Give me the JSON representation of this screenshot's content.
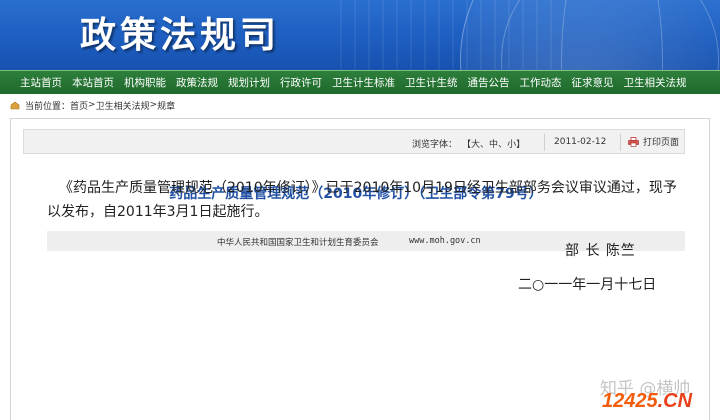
{
  "banner": {
    "title": "政策法规司"
  },
  "nav": {
    "items": [
      "主站首页",
      "本站首页",
      "机构职能",
      "政策法规",
      "规划计划",
      "行政许可",
      "卫生计生标准",
      "卫生计生统",
      "通告公告",
      "工作动态",
      "征求意见",
      "卫生相关法规"
    ]
  },
  "breadcrumb": {
    "label": "当前位置：",
    "home": "首页",
    "sep1": ">",
    "section": "卫生相关法规",
    "sep2": ">",
    "current": "规章"
  },
  "toolbar": {
    "font_label": "浏览字体：",
    "font_open": "【",
    "font_large": "大",
    "font_medium": "中",
    "font_small": "小",
    "font_close": "】",
    "font_sep1": "、",
    "font_sep2": "、",
    "date": "2011-02-12",
    "print": "打印页面"
  },
  "article": {
    "title": "药品生产质量管理规范（2010年修订）（卫生部令第79号）",
    "source_org": "中华人民共和国国家卫生和计划生育委员会",
    "source_site": "www.moh.gov.cn",
    "body": "《药品生产质量管理规范（2010年修订）》已于2010年10月19日经卫生部部务会议审议通过，现予以发布，自2011年3月1日起施行。",
    "sign": "部 长  陈竺",
    "sign_date": "二○一一年一月十七日"
  },
  "watermarks": {
    "zhihu": "知乎 @横帅",
    "site_num": "12425",
    "site_tld": ".CN"
  },
  "colors": {
    "banner_blue": "#1d5ec0",
    "nav_green": "#2d7e3b",
    "title_blue": "#2251a3",
    "watermark_orange": "#f25c0a"
  }
}
